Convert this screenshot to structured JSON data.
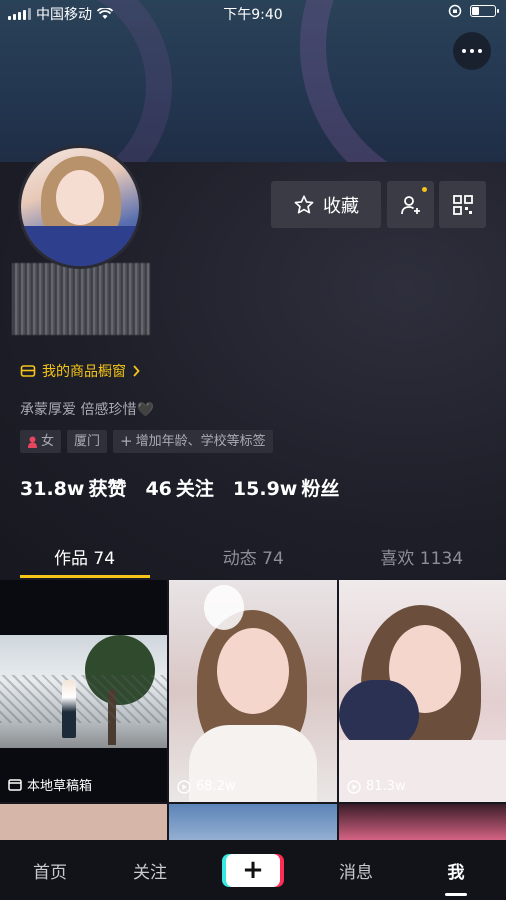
{
  "status_bar": {
    "carrier": "中国移动",
    "time": "下午9:40",
    "battery_level": 0.35
  },
  "profile": {
    "shop_link": "我的商品橱窗",
    "favorite_button": "收藏",
    "bio": "承蒙厚爱 倍感珍惜🖤",
    "tags": [
      "女",
      "厦门",
      "增加年龄、学校等标签"
    ],
    "stats": [
      {
        "value": "31.8w",
        "label": "获赞"
      },
      {
        "value": "46",
        "label": "关注"
      },
      {
        "value": "15.9w",
        "label": "粉丝"
      }
    ]
  },
  "tabs": [
    {
      "label": "作品 74",
      "active": true
    },
    {
      "label": "动态 74",
      "active": false
    },
    {
      "label": "喜欢 1134",
      "active": false
    }
  ],
  "grid": {
    "draft_label": "本地草稿箱",
    "video_2_plays": "68.2w",
    "video_3_plays": "81.3w"
  },
  "bottom_nav": {
    "home": "首页",
    "following": "关注",
    "messages": "消息",
    "me": "我"
  },
  "colors": {
    "accent_yellow": "#f5c518",
    "background": "#16171f"
  }
}
